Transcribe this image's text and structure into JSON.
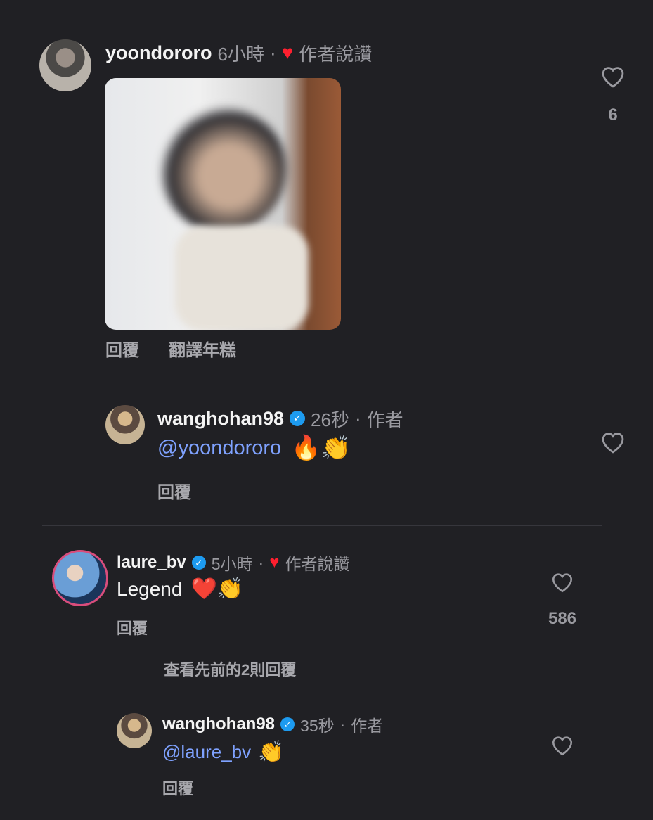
{
  "comments": [
    {
      "username": "yoondororo",
      "time": "6小時",
      "separator": "·",
      "author_liked": "作者說讚",
      "likes": "6",
      "actions": [
        "回覆",
        "翻譯年糕"
      ]
    },
    {
      "username": "wanghohan98",
      "time": "26秒",
      "separator": "·",
      "author_label": "作者",
      "mention": "@yoondororo",
      "emojis": "🔥👏",
      "actions": [
        "回覆"
      ]
    },
    {
      "username": "laure_bv",
      "time": "5小時",
      "separator": "·",
      "author_liked": "作者說讚",
      "text": "Legend",
      "emojis": "❤️👏",
      "likes": "586",
      "actions": [
        "回覆"
      ],
      "view_replies": "查看先前的2則回覆"
    },
    {
      "username": "wanghohan98",
      "time": "35秒",
      "separator": "·",
      "author_label": "作者",
      "mention": "@laure_bv",
      "emojis": "👏",
      "actions": [
        "回覆"
      ]
    }
  ],
  "colors": {
    "background": "#202024",
    "mention": "#7fa2ff",
    "heart": "#ff1f2f",
    "verified": "#1d9bf0"
  },
  "icons": [
    "heart-outline-icon",
    "verified-badge-icon",
    "red-heart-icon"
  ]
}
